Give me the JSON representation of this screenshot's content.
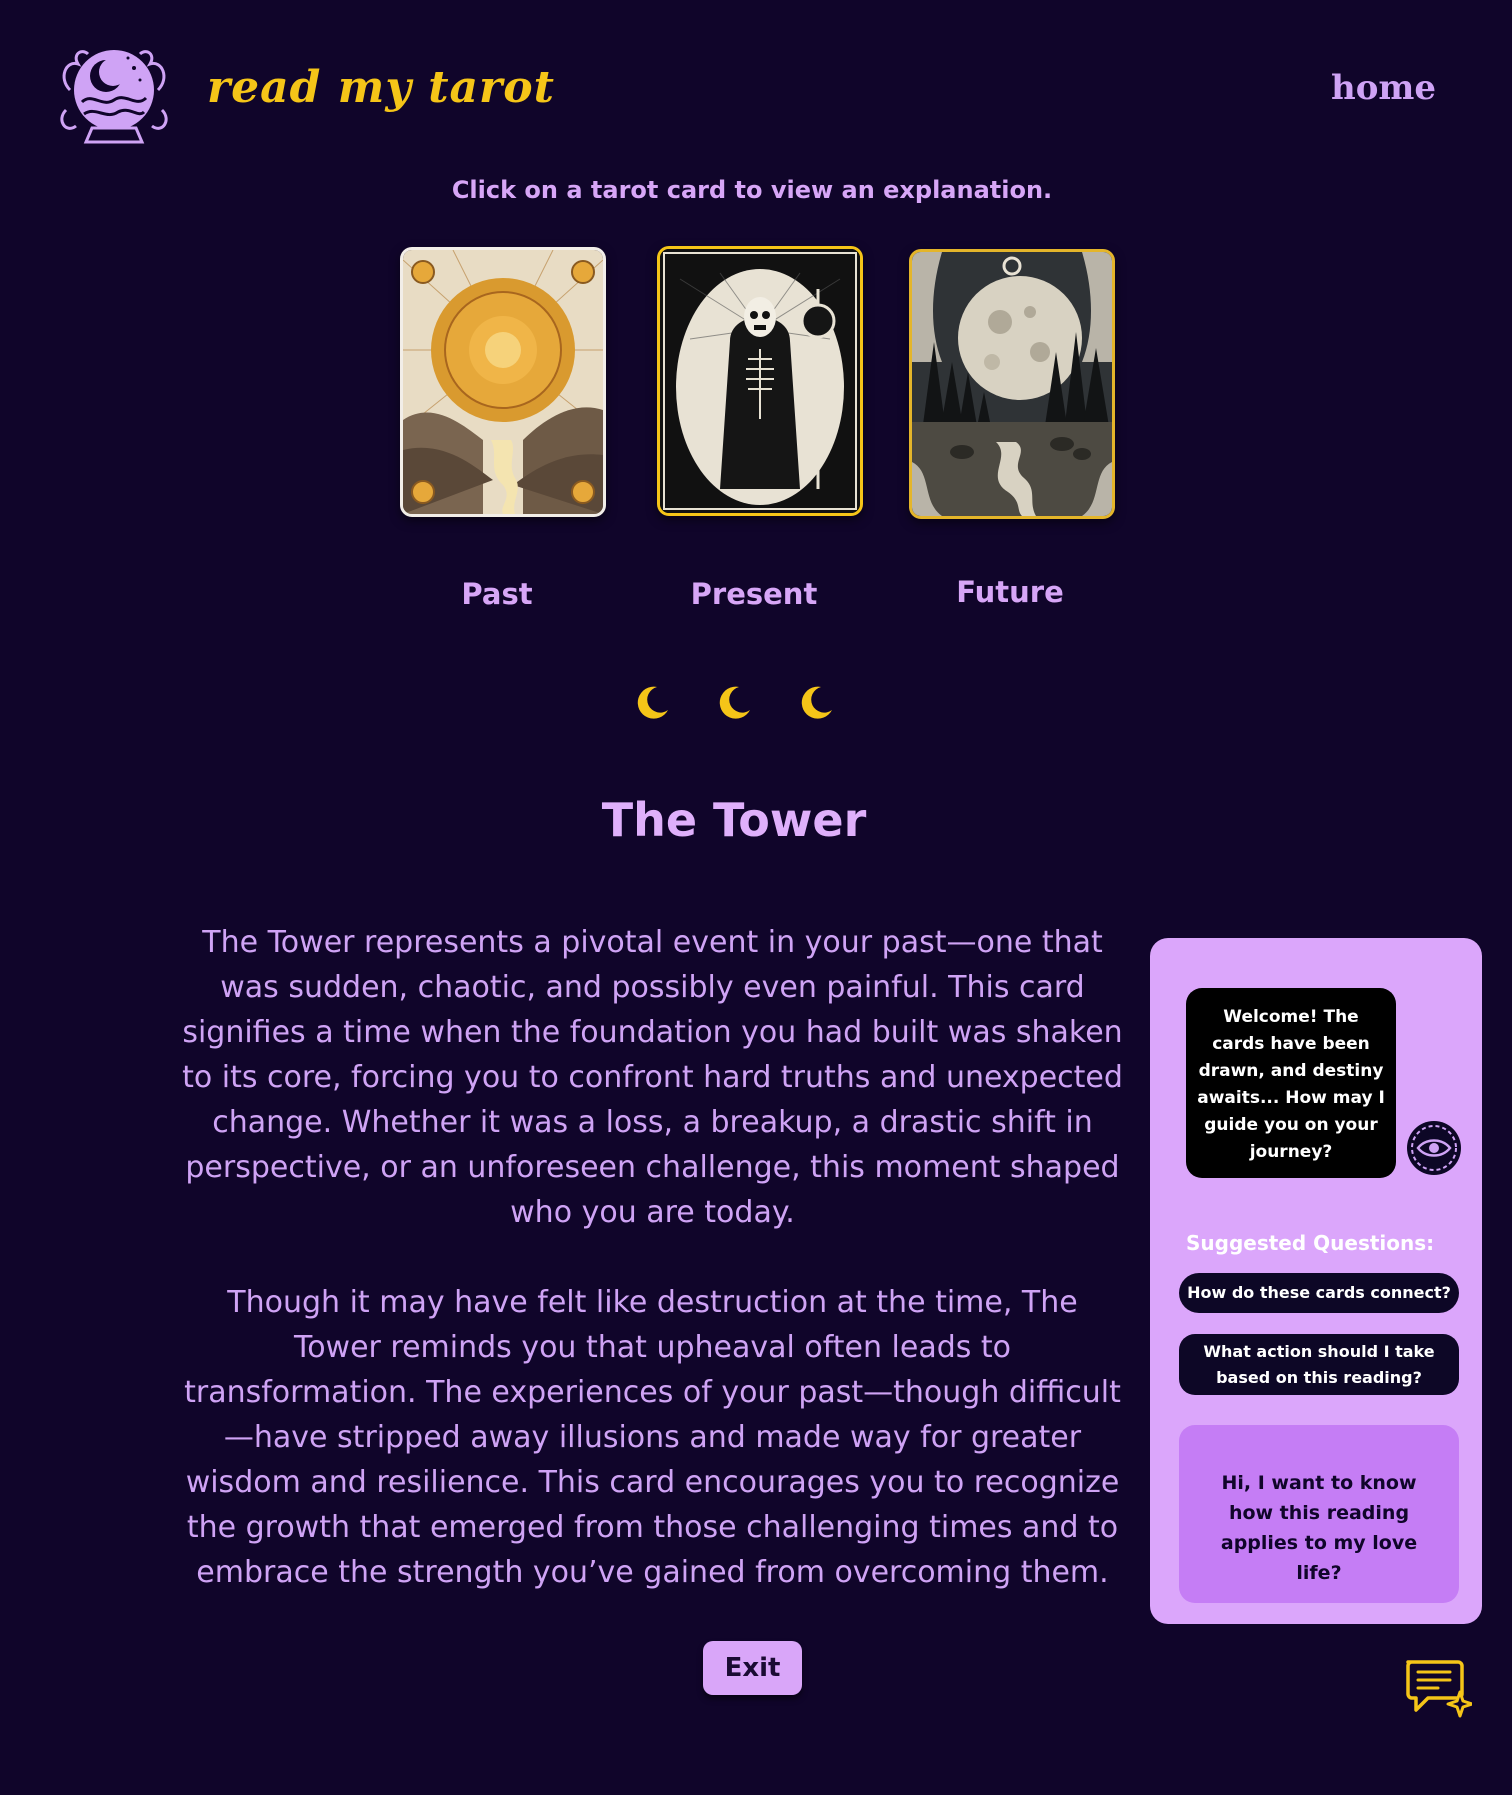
{
  "header": {
    "brand": "read my tarot",
    "nav_home": "home",
    "logo_icon": "crystal-ball-moon-icon"
  },
  "instruction": "Click on a tarot card to view an explanation.",
  "cards": [
    {
      "position": "Past",
      "image": "sun-over-valley-card"
    },
    {
      "position": "Present",
      "image": "death-skeleton-card"
    },
    {
      "position": "Future",
      "image": "moon-over-forest-card"
    }
  ],
  "progress": {
    "icon": "crescent-moon-icon",
    "count": 3,
    "color": "#f5c518"
  },
  "reading": {
    "title": "The Tower",
    "paragraphs": [
      "The Tower represents a pivotal event in your past—one that was sudden, chaotic, and possibly even painful. This card signifies a time when the foundation you had built was shaken to its core, forcing you to confront hard truths and unexpected change. Whether it was a loss, a breakup, a drastic shift in perspective, or an unforeseen challenge, this moment shaped who you are today.",
      "Though it may have felt like destruction at the time, The Tower reminds you that upheaval often leads to transformation. The experiences of your past—though difficult—have stripped away illusions and made way for greater wisdom and resilience. This card encourages you to recognize the growth that emerged from those challenging times and to embrace the strength you’ve gained from overcoming them."
    ],
    "exit_label": "Exit"
  },
  "chat": {
    "bot_message": "Welcome!  The cards have been drawn, and destiny awaits... How may I guide you on your journey?",
    "bot_avatar": "eye-avatar-icon",
    "suggested_heading": "Suggested Questions:",
    "suggestions": [
      "How do these cards connect?",
      "What action should I take based on this reading?"
    ],
    "user_input": "Hi, I want to know  how this reading applies to my love life?",
    "toggle_icon": "chat-sparkle-icon"
  },
  "colors": {
    "background": "#10052a",
    "accent_gold": "#f5c518",
    "lavender": "#cfa3f5",
    "panel": "#dba6fb"
  }
}
